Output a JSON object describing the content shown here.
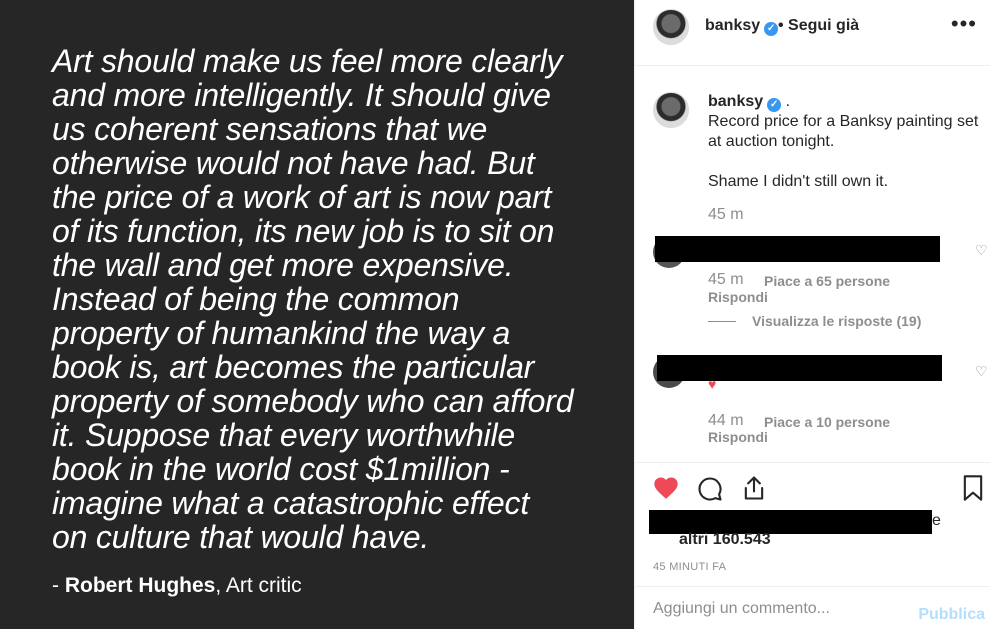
{
  "post": {
    "quote": "Art should make us feel more clearly\nand more intelligently. It should give\nus coherent sensations that we\notherwise would not have had. But\nthe price of a work of art is now part\nof its function, its new job is to sit on\nthe wall and get more expensive.\nInstead of being the common\nproperty of humankind the way a\nbook is, art becomes the particular\nproperty of somebody who can afford\nit. Suppose that every worthwhile\nbook in the world cost $1million -\nimagine what a catastrophic effect\non culture that would have.",
    "attribution_prefix": "- ",
    "author": "Robert Hughes",
    "author_suffix": ", Art critic"
  },
  "header": {
    "username": "banksy",
    "follow_label": "• Segui già",
    "verified_glyph": "✓"
  },
  "caption": {
    "username": "banksy",
    "dot": ".",
    "line1": "Record price for a Banksy painting set",
    "line2": "at auction tonight.",
    "line3": "Shame I didn't still own it.",
    "time": "45 m"
  },
  "comments": [
    {
      "time": "45 m",
      "likes": "Piace a 65 persone",
      "reply": "Rispondi",
      "view_replies": "Visualizza le risposte (19)"
    },
    {
      "time": "44 m",
      "likes": "Piace a 10 persone",
      "reply": "Rispondi",
      "heart": "♥"
    }
  ],
  "actions": {
    "likes_suffix": "e",
    "likes_count": "altri 160.543",
    "ago": "45 MINUTI FA"
  },
  "add_comment": {
    "placeholder": "Aggiungi un commento...",
    "publish": "Pubblica"
  },
  "icons": {
    "like": "heart-icon",
    "comment": "comment-icon",
    "share": "share-icon",
    "save": "bookmark-icon",
    "more": "more-icon"
  },
  "colors": {
    "like_red": "#ed4956",
    "verified_blue": "#3897f0",
    "image_bg": "#262626"
  }
}
